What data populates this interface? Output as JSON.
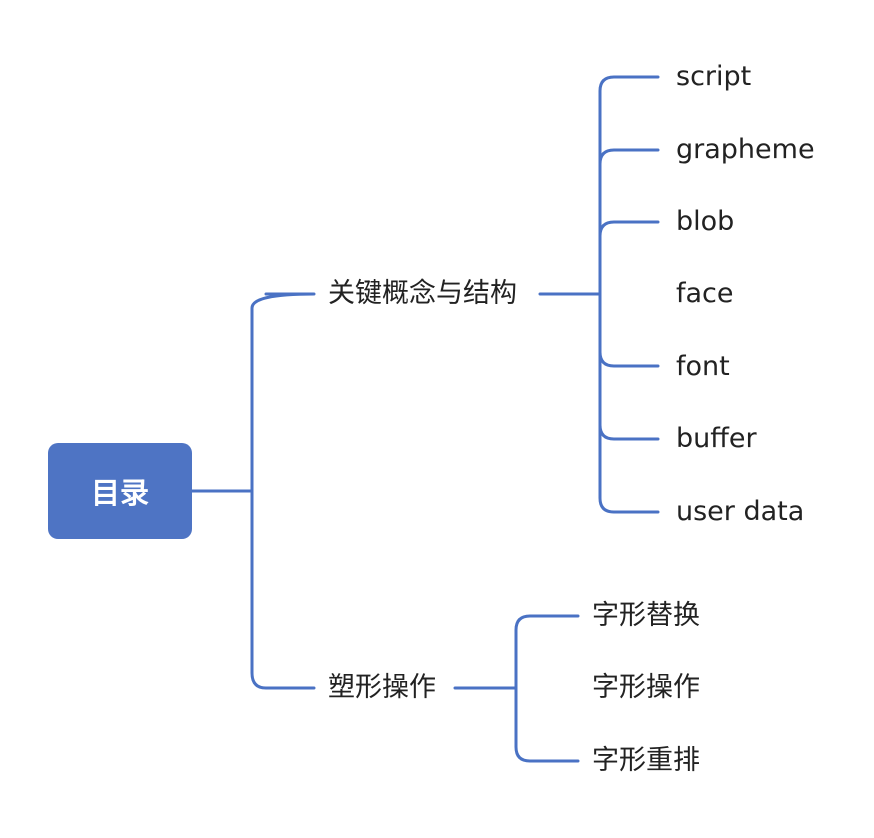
{
  "colors": {
    "connector": "#4a72c4",
    "root_fill": "#4e74c4",
    "text": "#222222",
    "root_text": "#ffffff"
  },
  "root": {
    "label": "目录"
  },
  "branches": [
    {
      "label": "关键概念与结构",
      "children": [
        "script",
        "grapheme",
        "blob",
        "face",
        "font",
        "buffer",
        "user data"
      ]
    },
    {
      "label": "塑形操作",
      "children": [
        "字形替换",
        "字形操作",
        "字形重排"
      ]
    }
  ]
}
